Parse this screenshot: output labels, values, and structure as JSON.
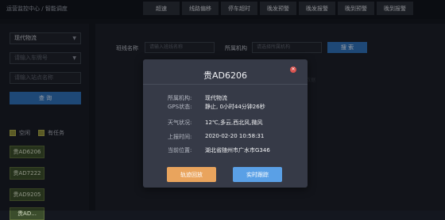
{
  "breadcrumb": {
    "part1": "运营监控中心",
    "sep": "/",
    "part2": "智能调度"
  },
  "tabs": [
    "超速",
    "线路偏移",
    "停车超时",
    "晚发预警",
    "晚发报警",
    "晚到预警",
    "晚到报警"
  ],
  "sidebar": {
    "org_select": "现代物流",
    "plate_placeholder": "请输入车牌号",
    "station_placeholder": "请输入站点名称",
    "query_button": "查 询",
    "legend": {
      "idle": "空闲",
      "busy": "有任务"
    },
    "vehicles": [
      "贵AD6206",
      "贵AD7222",
      "贵AD9205",
      "贵AD..."
    ]
  },
  "main": {
    "route_label": "班线名称",
    "route_placeholder": "请输入班线名称",
    "org_label": "所属机构",
    "org_placeholder": "请选择所属机构",
    "search_button": "搜 索",
    "no_data": "暂无数据"
  },
  "modal": {
    "title": "贵AD6206",
    "close_icon": "close-icon",
    "rows": [
      {
        "label": "所属机构:",
        "value": "现代物流"
      },
      {
        "label": "GPS状态:",
        "value": "静止, 0小时44分钟26秒"
      },
      {
        "label": "天气状况:",
        "value": "12℃,多云,西北风,微风"
      },
      {
        "label": "上报时间:",
        "value": "2020-02-20 10:58:31"
      },
      {
        "label": "当前位置:",
        "value": "湖北省随州市广水市G346"
      }
    ],
    "track_button": "轨迹回放",
    "live_button": "实时跟踪"
  },
  "colors": {
    "primary": "#2f6fb6",
    "orange": "#e9a45d",
    "blue": "#5aa0e6",
    "close": "#d9534f"
  }
}
